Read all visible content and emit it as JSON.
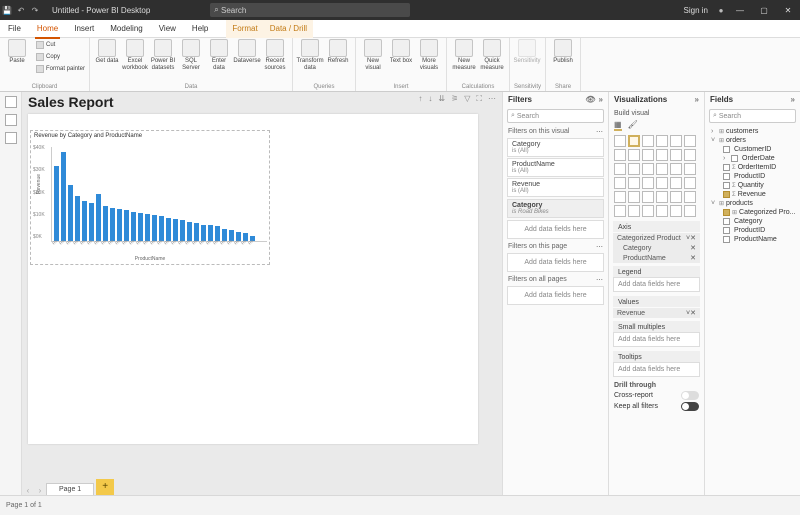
{
  "app": {
    "title": "Untitled - Power BI Desktop",
    "search_placeholder": "Search",
    "signin": "Sign in",
    "status": "Page 1 of 1"
  },
  "menu": {
    "file": "File",
    "home": "Home",
    "insert": "Insert",
    "modeling": "Modeling",
    "view": "View",
    "help": "Help",
    "format": "Format",
    "datadrill": "Data / Drill"
  },
  "ribbon": {
    "clipboard": {
      "label": "Clipboard",
      "paste": "Paste",
      "cut": "Cut",
      "copy": "Copy",
      "fp": "Format painter"
    },
    "data": {
      "label": "Data",
      "get": "Get data",
      "excel": "Excel workbook",
      "pbi": "Power BI datasets",
      "sql": "SQL Server",
      "enter": "Enter data",
      "dv": "Dataverse",
      "recent": "Recent sources"
    },
    "queries": {
      "label": "Queries",
      "transform": "Transform data",
      "refresh": "Refresh"
    },
    "insert": {
      "label": "Insert",
      "newv": "New visual",
      "textbox": "Text box",
      "more": "More visuals"
    },
    "calc": {
      "label": "Calculations",
      "newm": "New measure",
      "quick": "Quick measure"
    },
    "sens": {
      "label": "Sensitivity",
      "btn": "Sensitivity"
    },
    "share": {
      "label": "Share",
      "btn": "Publish"
    }
  },
  "report": {
    "title": "Sales Report",
    "page_tab": "Page 1"
  },
  "chart_data": {
    "type": "bar",
    "title": "Revenue by Category and ProductName",
    "xlabel": "ProductName",
    "ylabel": "Revenue",
    "ylim": [
      0,
      40000
    ],
    "yticks": [
      "$40K",
      "$30K",
      "$20K",
      "$10K",
      "$0K"
    ],
    "categories": [
      "Road-150",
      "Road-250",
      "Road-350",
      "Road-450",
      "Road-550",
      "Road-650",
      "Road-750",
      "Road-850",
      "Road-950",
      "Road-150 B",
      "Road-250 B",
      "Road-350 B",
      "Road-450 B",
      "Road-550 B",
      "Road-650 B",
      "Road-750 B",
      "Road-850 B",
      "Road-950 B",
      "Road-150 R",
      "Road-250 R",
      "Road-350 R",
      "Road-450 R",
      "Road-550 R",
      "Road-650 R",
      "Road-750 R",
      "Road-850 R",
      "Road-950 R",
      "Road-X1",
      "Road-X2"
    ],
    "values": [
      32000,
      38000,
      24000,
      19000,
      17000,
      16000,
      20000,
      15000,
      14000,
      13500,
      13000,
      12500,
      12000,
      11500,
      11000,
      10500,
      10000,
      9500,
      9000,
      8000,
      7500,
      7000,
      6800,
      6600,
      5000,
      4500,
      4000,
      3500,
      2000
    ]
  },
  "filters": {
    "header": "Filters",
    "search": "Search",
    "sec_visual": "Filters on this visual",
    "cards": [
      {
        "name": "Category",
        "sub": "is (All)"
      },
      {
        "name": "ProductName",
        "sub": "is (All)"
      },
      {
        "name": "Revenue",
        "sub": "is (All)"
      }
    ],
    "summary": {
      "name": "Category",
      "sub": "is Road Bikes"
    },
    "add": "Add data fields here",
    "sec_page": "Filters on this page",
    "sec_all": "Filters on all pages"
  },
  "viz": {
    "header": "Visualizations",
    "build": "Build visual",
    "axis": "Axis",
    "axis_field": "Categorized Product",
    "axis_sub1": "Category",
    "axis_sub2": "ProductName",
    "legend": "Legend",
    "values": "Values",
    "values_field": "Revenue",
    "small": "Small multiples",
    "tooltips": "Tooltips",
    "drill": "Drill through",
    "cross": "Cross-report",
    "keep": "Keep all filters",
    "add": "Add data fields here"
  },
  "fields": {
    "header": "Fields",
    "search": "Search",
    "tables": [
      {
        "name": "customers",
        "expanded": false
      },
      {
        "name": "orders",
        "expanded": true,
        "cols": [
          {
            "name": "CustomerID",
            "checked": false,
            "icon": ""
          },
          {
            "name": "OrderDate",
            "checked": false,
            "icon": "",
            "haschev": true
          },
          {
            "name": "OrderItemID",
            "checked": false,
            "icon": "Σ"
          },
          {
            "name": "ProductID",
            "checked": false,
            "icon": ""
          },
          {
            "name": "Quantity",
            "checked": false,
            "icon": "Σ"
          },
          {
            "name": "Revenue",
            "checked": true,
            "icon": "Σ"
          }
        ]
      },
      {
        "name": "products",
        "expanded": true,
        "cols": [
          {
            "name": "Categorized Pro...",
            "checked": true,
            "icon": "⊞"
          },
          {
            "name": "Category",
            "checked": false,
            "icon": ""
          },
          {
            "name": "ProductID",
            "checked": false,
            "icon": ""
          },
          {
            "name": "ProductName",
            "checked": false,
            "icon": ""
          }
        ]
      }
    ]
  }
}
